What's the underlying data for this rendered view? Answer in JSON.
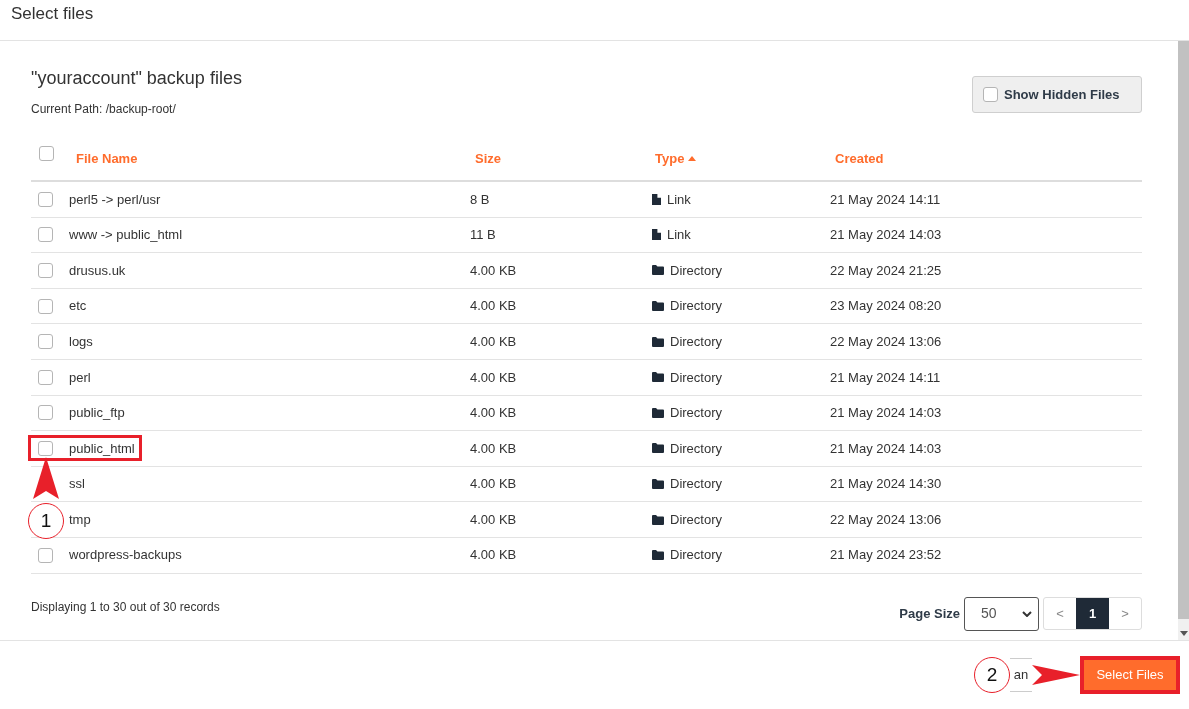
{
  "dialog": {
    "title": "Select files"
  },
  "panel": {
    "heading": "\"youraccount\" backup files",
    "current_path": "Current Path: /backup-root/",
    "hidden_toggle": {
      "label": "Show Hidden Files",
      "checked": false
    }
  },
  "table": {
    "select_all": {
      "checked": false
    },
    "columns": [
      {
        "label": "File Name",
        "sorted": false
      },
      {
        "label": "Size",
        "sorted": false
      },
      {
        "label": "Type",
        "sorted": true
      },
      {
        "label": "Created",
        "sorted": false
      }
    ],
    "rows": [
      {
        "name": "perl5 -> perl/usr",
        "size": "8 B",
        "kind": "link",
        "type": "Link",
        "created": "21 May 2024 14:11",
        "checked": false,
        "highlighted": false
      },
      {
        "name": "www -> public_html",
        "size": "11 B",
        "kind": "link",
        "type": "Link",
        "created": "21 May 2024 14:03",
        "checked": false,
        "highlighted": false
      },
      {
        "name": "drusus.uk",
        "size": "4.00 KB",
        "kind": "directory",
        "type": "Directory",
        "created": "22 May 2024 21:25",
        "checked": false,
        "highlighted": false
      },
      {
        "name": "etc",
        "size": "4.00 KB",
        "kind": "directory",
        "type": "Directory",
        "created": "23 May 2024 08:20",
        "checked": false,
        "highlighted": false
      },
      {
        "name": "logs",
        "size": "4.00 KB",
        "kind": "directory",
        "type": "Directory",
        "created": "22 May 2024 13:06",
        "checked": false,
        "highlighted": false
      },
      {
        "name": "perl",
        "size": "4.00 KB",
        "kind": "directory",
        "type": "Directory",
        "created": "21 May 2024 14:11",
        "checked": false,
        "highlighted": false
      },
      {
        "name": "public_ftp",
        "size": "4.00 KB",
        "kind": "directory",
        "type": "Directory",
        "created": "21 May 2024 14:03",
        "checked": false,
        "highlighted": false
      },
      {
        "name": "public_html",
        "size": "4.00 KB",
        "kind": "directory",
        "type": "Directory",
        "created": "21 May 2024 14:03",
        "checked": false,
        "highlighted": true
      },
      {
        "name": "ssl",
        "size": "4.00 KB",
        "kind": "directory",
        "type": "Directory",
        "created": "21 May 2024 14:30",
        "highlighted": false
      },
      {
        "name": "tmp",
        "size": "4.00 KB",
        "kind": "directory",
        "type": "Directory",
        "created": "22 May 2024 13:06",
        "highlighted": false
      },
      {
        "name": "wordpress-backups",
        "size": "4.00 KB",
        "kind": "directory",
        "type": "Directory",
        "created": "21 May 2024 23:52",
        "checked": false,
        "highlighted": false
      }
    ]
  },
  "records": "Displaying 1 to 30 out of 30 records",
  "pagination": {
    "page_size_label": "Page Size",
    "page_size": "50",
    "prev": "<",
    "next": ">",
    "pages": [
      {
        "label": "1",
        "selected": true
      }
    ]
  },
  "footer": {
    "cancel": {
      "label": "an"
    },
    "select": {
      "label": "Select Files",
      "highlighted": true
    }
  },
  "callouts": [
    {
      "label": "1"
    },
    {
      "label": "2"
    }
  ]
}
